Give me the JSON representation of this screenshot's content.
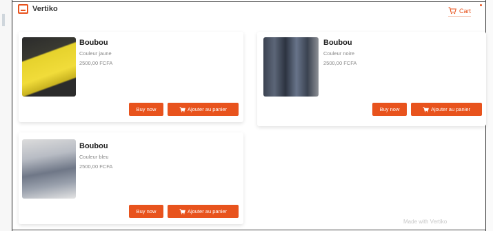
{
  "header": {
    "title": "Vertiko",
    "brand_icon": "shop-icon"
  },
  "cart": {
    "label": "Cart",
    "icon": "cart-icon"
  },
  "accent_color": "#e8531d",
  "products": [
    {
      "name": "Boubou",
      "description": "Couleur jaune",
      "price": "2500,00 FCFA",
      "buy_label": "Buy now",
      "add_label": "Ajouter au panier"
    },
    {
      "name": "Boubou",
      "description": "Couleur noire",
      "price": "2500,00 FCFA",
      "buy_label": "Buy now",
      "add_label": "Ajouter au panier"
    },
    {
      "name": "Boubou",
      "description": "Couleur bleu",
      "price": "2500,00 FCFA",
      "buy_label": "Buy now",
      "add_label": "Ajouter au panier"
    }
  ],
  "footer": {
    "text": "Made with Vertiko"
  }
}
